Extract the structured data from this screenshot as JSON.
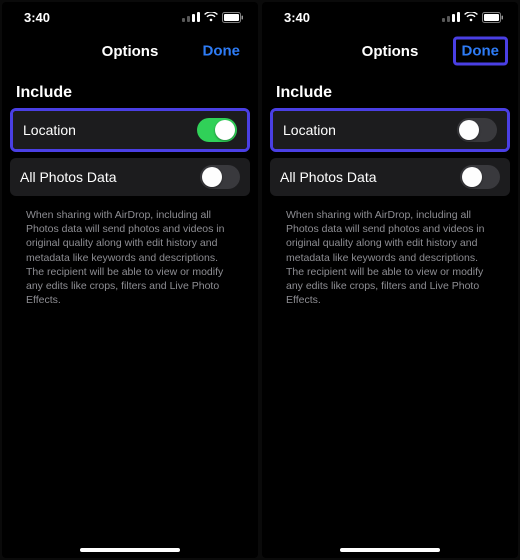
{
  "statusTime": "3:40",
  "navTitle": "Options",
  "doneLabel": "Done",
  "sectionHeader": "Include",
  "rows": {
    "location": {
      "label": "Location"
    },
    "allPhotos": {
      "label": "All Photos Data"
    }
  },
  "footerText": "When sharing with AirDrop, including all Photos data will send photos and videos in original quality along with edit history and metadata like keywords and descriptions. The recipient will be able to view or modify any edits like crops, filters and Live Photo Effects.",
  "screens": {
    "left": {
      "locationOn": true,
      "doneHighlighted": false
    },
    "right": {
      "locationOn": false,
      "doneHighlighted": true
    }
  },
  "colors": {
    "accentBlue": "#2e7cf6",
    "highlight": "#4a3fe4",
    "toggleOn": "#30d158",
    "cellBg": "#1c1c1e"
  }
}
